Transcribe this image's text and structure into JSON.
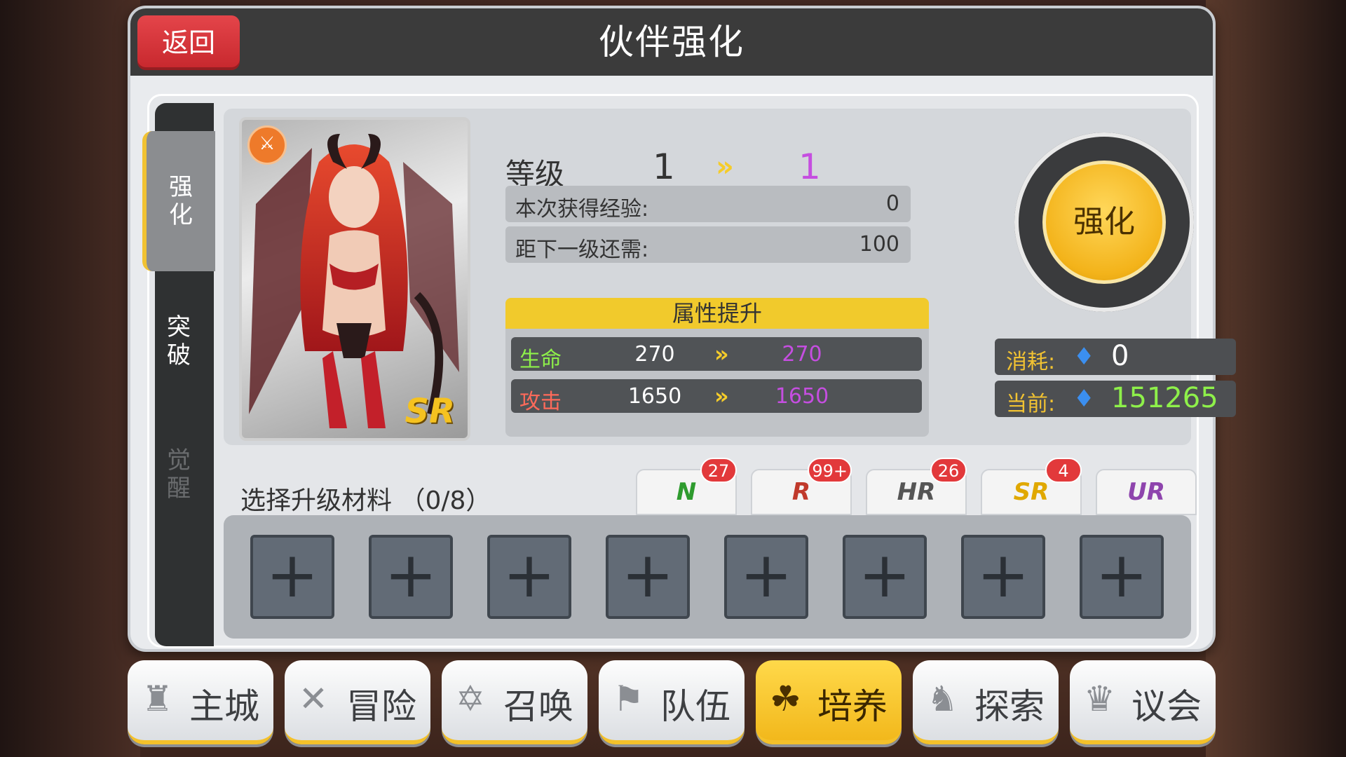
{
  "header": {
    "title": "伙伴强化",
    "back_label": "返回"
  },
  "side_tabs": [
    {
      "label": "强\n化",
      "state": "active"
    },
    {
      "label": "突\n破",
      "state": "normal"
    },
    {
      "label": "觉\n醒",
      "state": "disabled"
    }
  ],
  "card": {
    "rarity": "SR",
    "type_icon": "sword-icon"
  },
  "level": {
    "label": "等级",
    "current": "1",
    "next": "1"
  },
  "exp": {
    "gained_label": "本次获得经验:",
    "gained_value": "0",
    "needed_label": "距下一级还需:",
    "needed_value": "100"
  },
  "attributes": {
    "title": "属性提升",
    "rows": [
      {
        "name": "生命",
        "current": "270",
        "next": "270",
        "color": "#8ef04a"
      },
      {
        "name": "攻击",
        "current": "1650",
        "next": "1650",
        "color": "#ff6a5a"
      }
    ]
  },
  "enhance_button": "强化",
  "cost": {
    "label": "消耗:",
    "value": "0",
    "current_label": "当前:",
    "current_value": "151265"
  },
  "materials": {
    "label": "选择升级材料 （0/8）",
    "tabs": [
      {
        "rarity": "N",
        "count": "27",
        "color": "#2e9b2e"
      },
      {
        "rarity": "R",
        "count": "99+",
        "color": "#c0392b"
      },
      {
        "rarity": "HR",
        "count": "26",
        "color": "#555555"
      },
      {
        "rarity": "SR",
        "count": "4",
        "color": "#e0a800"
      },
      {
        "rarity": "UR",
        "count": "",
        "color": "#8e44ad"
      }
    ],
    "slots": 8
  },
  "nav": [
    {
      "label": "主城",
      "icon": "castle-icon",
      "active": false
    },
    {
      "label": "冒险",
      "icon": "crossed-swords-icon",
      "active": false
    },
    {
      "label": "召唤",
      "icon": "summon-circle-icon",
      "active": false
    },
    {
      "label": "队伍",
      "icon": "team-flag-icon",
      "active": false
    },
    {
      "label": "培养",
      "icon": "cultivate-icon",
      "active": true
    },
    {
      "label": "探索",
      "icon": "explore-icon",
      "active": false
    },
    {
      "label": "议会",
      "icon": "council-icon",
      "active": false
    }
  ]
}
